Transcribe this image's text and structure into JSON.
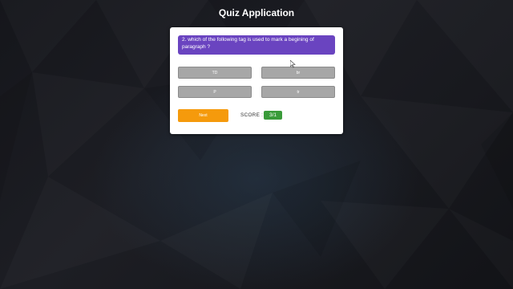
{
  "app": {
    "title": "Quiz Application"
  },
  "quiz": {
    "question": "2. which of the following tag is used to mark a begining of paragraph ?",
    "options": [
      "TD",
      "br",
      "P",
      "tr"
    ],
    "next_label": "Next",
    "score_label": "SCORE :",
    "score_value": "3/1"
  },
  "colors": {
    "question_bg": "#6a44c0",
    "option_bg": "#a7a7a7",
    "next_bg": "#f59a0c",
    "score_bg": "#3a9b3a"
  },
  "icons": {
    "cursor": "mouse-pointer-icon"
  }
}
